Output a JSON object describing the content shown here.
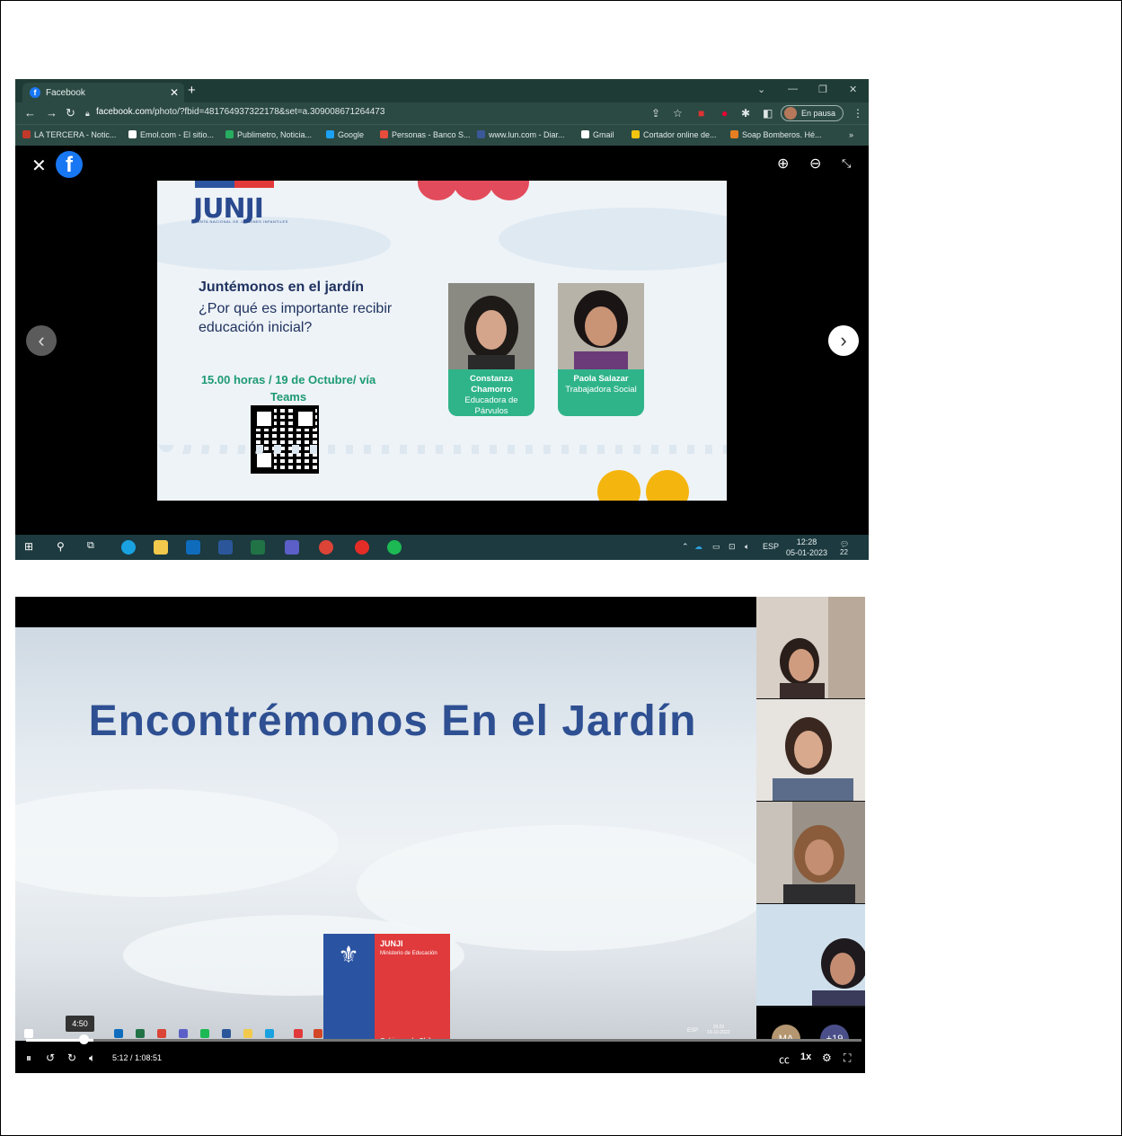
{
  "browser": {
    "tab_title": "Facebook",
    "url_host": "facebook.com",
    "url_path": "/photo/?fbid=481764937322178&set=a.309008671264473",
    "profile_status": "En pausa",
    "bookmarks": [
      {
        "label": "LA TERCERA - Notic...",
        "color": "#c0392b"
      },
      {
        "label": "Emol.com - El sitio...",
        "color": "#ffffff"
      },
      {
        "label": "Publimetro, Noticia...",
        "color": "#27ae60"
      },
      {
        "label": "Google",
        "color": "#1da1f2"
      },
      {
        "label": "Personas - Banco S...",
        "color": "#e74c3c"
      },
      {
        "label": "www.lun.com - Diar...",
        "color": "#3b5998"
      },
      {
        "label": "Gmail",
        "color": "#ffffff"
      },
      {
        "label": "Cortador online de...",
        "color": "#f1c40f"
      },
      {
        "label": "Soap Bomberos. Hé...",
        "color": "#e67e22"
      }
    ]
  },
  "slide1": {
    "logo": "JUNJI",
    "logo_sub": "JUNTA NACIONAL DE JARDINES INFANTILES",
    "title": "Juntémonos en el jardín",
    "question": "¿Por qué es importante recibir educación inicial?",
    "when": "15.00 horas / 19 de Octubre/ vía Teams",
    "speakers": [
      {
        "name": "Constanza Chamorro",
        "role": "Educadora de Párvulos"
      },
      {
        "name": "Paola Salazar",
        "role": "Trabajadora Social"
      }
    ]
  },
  "taskbar1": {
    "lang": "ESP",
    "time": "12:28",
    "date": "05-01-2023",
    "notifications": "22"
  },
  "video": {
    "title": "Encontrémonos En el Jardín",
    "logo_name": "JUNJI",
    "logo_ministry": "Ministerio de Educación",
    "logo_gov": "Gobierno de Chile",
    "hover_time": "4:50",
    "time": "5:12 / 1:08:51",
    "speed": "1x",
    "avatar_initials": "MA",
    "avatar_more": "+19",
    "inner_time": "19:23",
    "inner_date": "19-10-2022",
    "inner_lang": "ESP"
  }
}
